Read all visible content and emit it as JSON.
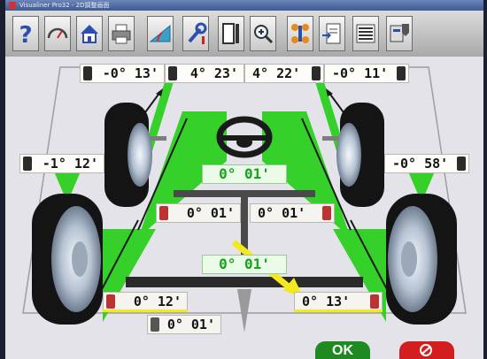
{
  "window": {
    "title": "Visualiner Pro32 - 2D調整画面"
  },
  "toolbar": {
    "buttons": [
      {
        "name": "help",
        "icon": "help-icon"
      },
      {
        "name": "gauge",
        "icon": "gauge-icon"
      },
      {
        "name": "home",
        "icon": "home-icon"
      },
      {
        "name": "print",
        "icon": "printer-icon"
      },
      {
        "name": "angle",
        "icon": "protractor-icon"
      },
      {
        "name": "adjust",
        "icon": "wrench-icon"
      },
      {
        "name": "vehicle",
        "icon": "vehicle-frame-icon"
      },
      {
        "name": "zoom",
        "icon": "zoom-icon"
      },
      {
        "name": "targets",
        "icon": "targets-icon"
      },
      {
        "name": "specs",
        "icon": "spec-sheet-icon"
      },
      {
        "name": "report",
        "icon": "report-icon"
      },
      {
        "name": "tools",
        "icon": "tools-icon"
      }
    ]
  },
  "readings": {
    "front_left_caster": "-0° 13'",
    "front_left_camber": "4° 23'",
    "front_right_camber": "4° 22'",
    "front_right_caster": "-0° 11'",
    "front_left_toe": "-1° 12'",
    "front_right_toe": "-0° 58'",
    "steering_center": "0° 01'",
    "rear_left_upper": "0° 01'",
    "rear_right_upper": "0° 01'",
    "thrust_angle": "0° 01'",
    "rear_left_toe": "0° 12'",
    "rear_right_toe": "0° 13'",
    "bottom_reading": "0° 01'"
  },
  "buttons": {
    "ok_label": "OK",
    "cancel_icon": "no-entry-icon"
  },
  "colors": {
    "indicator_green": "#35d02a",
    "highlight_yellow": "#f2ea1c",
    "ok_green": "#1f8a22",
    "cancel_red": "#d21e1e"
  }
}
